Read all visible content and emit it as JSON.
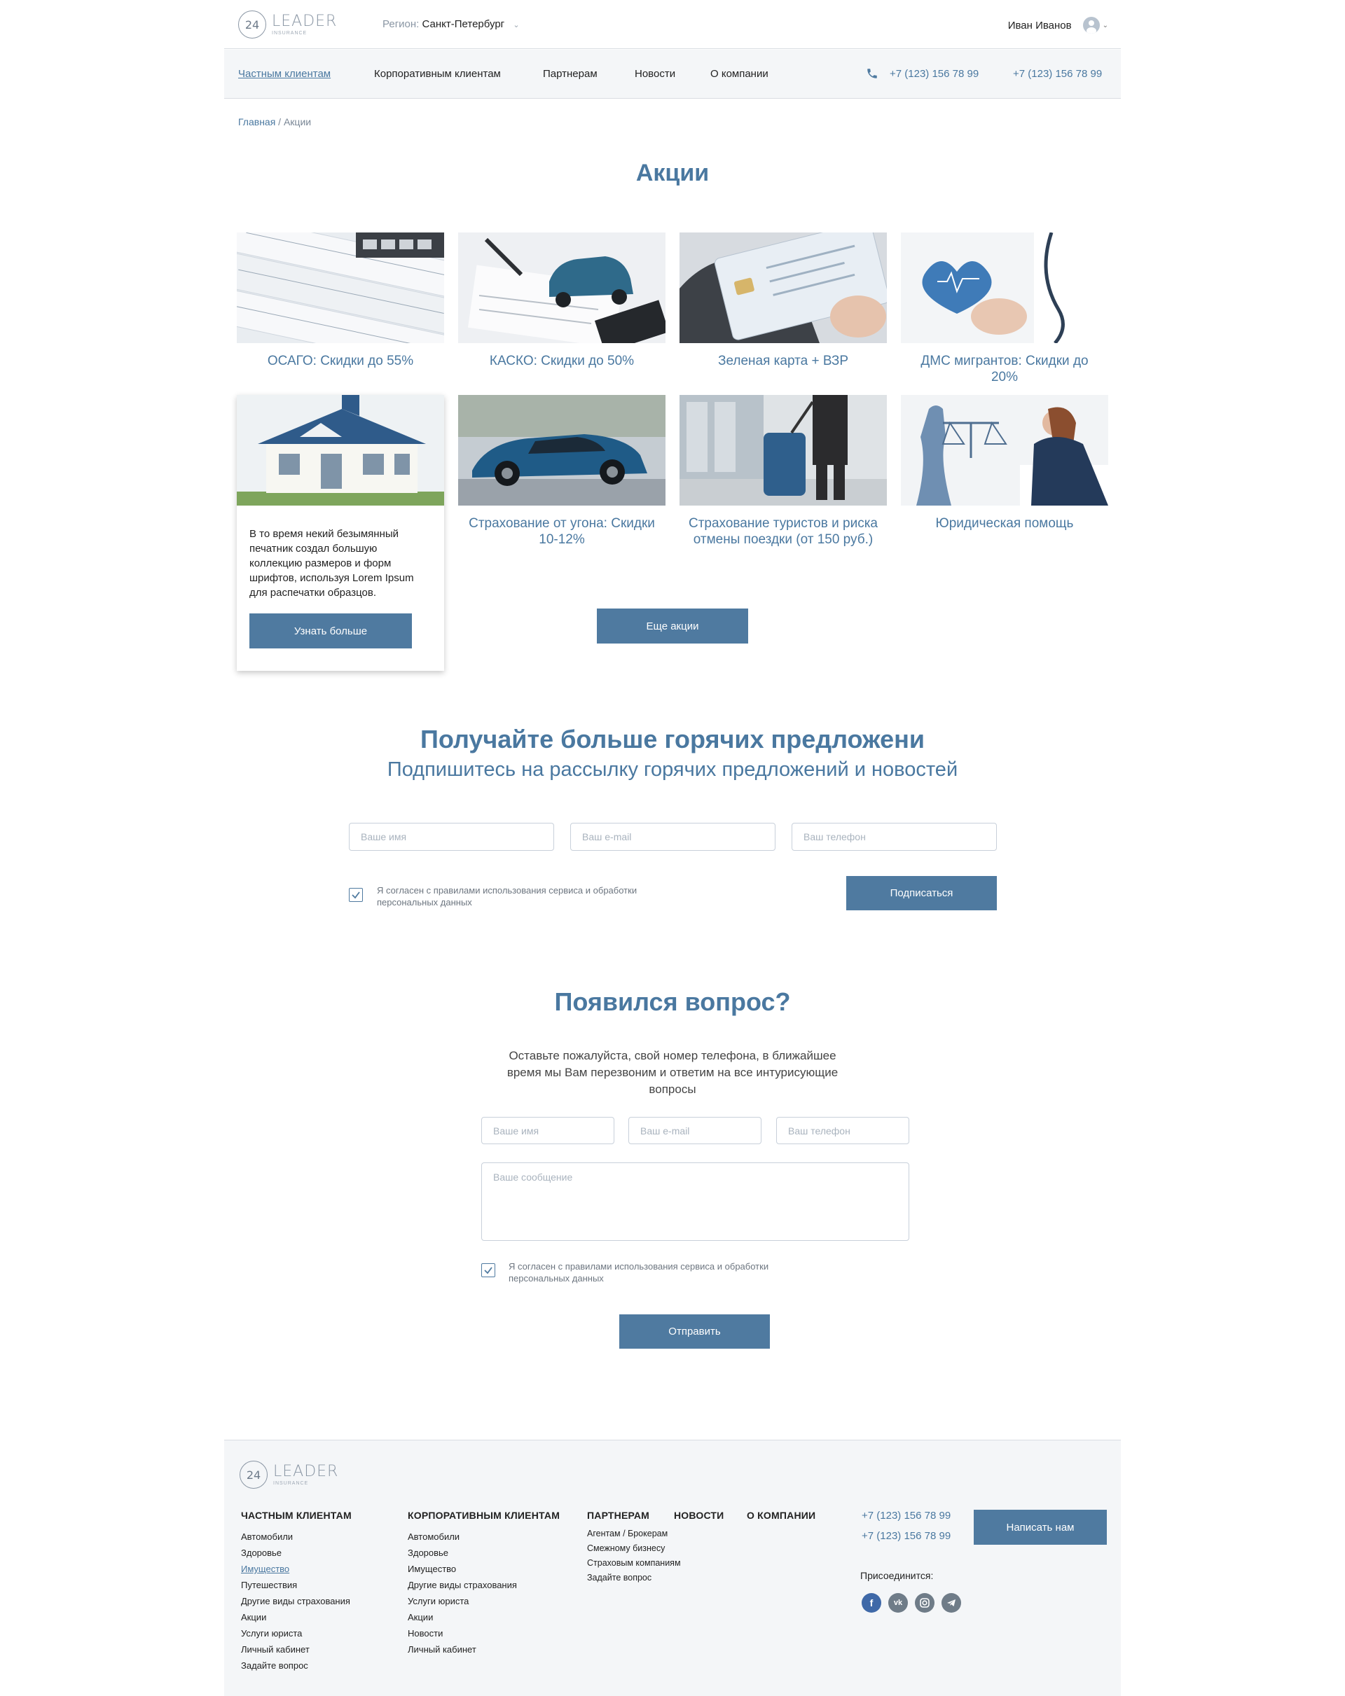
{
  "header": {
    "logo": {
      "badge": "24",
      "word": "LEADER",
      "sub": "INSURANCE"
    },
    "region_label": "Регион:",
    "region_value": "Санкт-Петербург",
    "user_name": "Иван Иванов"
  },
  "nav": {
    "items": [
      "Частным клиентам",
      "Корпоративным клиентам",
      "Партнерам",
      "Новости",
      "О компании"
    ],
    "phones": [
      "+7 (123) 156 78 99",
      "+7 (123) 156 78 99"
    ]
  },
  "breadcrumb": {
    "home": "Главная",
    "separator": " / ",
    "current": "Акции"
  },
  "promos": {
    "title": "Акции",
    "cards": [
      "ОСАГО: Скидки до 55%",
      "КАСКО: Скидки до 50%",
      "Зеленая карта + ВЗР",
      "ДМС мигрантов: Скидки до 20%",
      "",
      "Страхование от угона: Скидки 10-12%",
      "Страхование туристов и риска отмены поездки (от 150 руб.)",
      "Юридическая помощь"
    ],
    "expanded_desc": "В то время некий безымянный печатник создал большую коллекцию размеров и форм шрифтов, используя Lorem Ipsum для распечатки образцов.",
    "learn_more": "Узнать больше",
    "more_button": "Еще акции"
  },
  "subscribe": {
    "title": "Получайте больше горячих предложени",
    "subtitle": "Подпишитесь на рассылку горячих предложений и новостей",
    "name_placeholder": "Ваше имя",
    "email_placeholder": "Ваш e-mail",
    "phone_placeholder": "Ваш телефон",
    "consent": "Я согласен с правилами использования сервиса и обработки персональных данных",
    "button": "Подписаться"
  },
  "question": {
    "title": "Появился вопрос?",
    "text": "Оставьте пожалуйста, свой номер телефона, в ближайшее время мы Вам перезвоним и ответим на все интурисующие вопросы",
    "name_placeholder": "Ваше имя",
    "email_placeholder": "Ваш e-mail",
    "phone_placeholder": "Ваш телефон",
    "message_placeholder": "Ваше сообщение",
    "consent": "Я согласен с правилами использования сервиса и обработки персональных данных",
    "button": "Отправить"
  },
  "footer": {
    "private": {
      "title": "ЧАСТНЫМ КЛИЕНТАМ",
      "items": [
        "Автомобили",
        "Здоровье",
        "Имущество",
        "Путешествия",
        "Другие виды страхования",
        "Акции",
        "Услуги юриста",
        "Личный кабинет",
        "Задайте вопрос"
      ]
    },
    "corporate": {
      "title": "КОРПОРАТИВНЫМ КЛИЕНТАМ",
      "items": [
        "Автомобили",
        "Здоровье",
        "Имущество",
        "Другие виды страхования",
        "Услуги юриста",
        "Акции",
        "Новости",
        "Личный кабинет"
      ]
    },
    "partners": {
      "title": "ПАРТНЕРАМ",
      "items": [
        "Агентам / Брокерам",
        "Смежному бизнесу",
        "Страховым компаниям",
        "Задайте вопрос"
      ]
    },
    "news_title": "НОВОСТИ",
    "about_title": "О КОМПАНИИ",
    "phones": [
      "+7 (123) 156 78 99",
      "+7 (123) 156 78 99"
    ],
    "write_button": "Написать нам",
    "join_label": "Присоединится:",
    "social_icons": [
      "facebook-icon",
      "vk-icon",
      "instagram-icon",
      "telegram-icon"
    ]
  },
  "colors": {
    "accent": "#4a78a0",
    "button": "#4f7aa0",
    "footer_bg": "#f4f6f8"
  }
}
